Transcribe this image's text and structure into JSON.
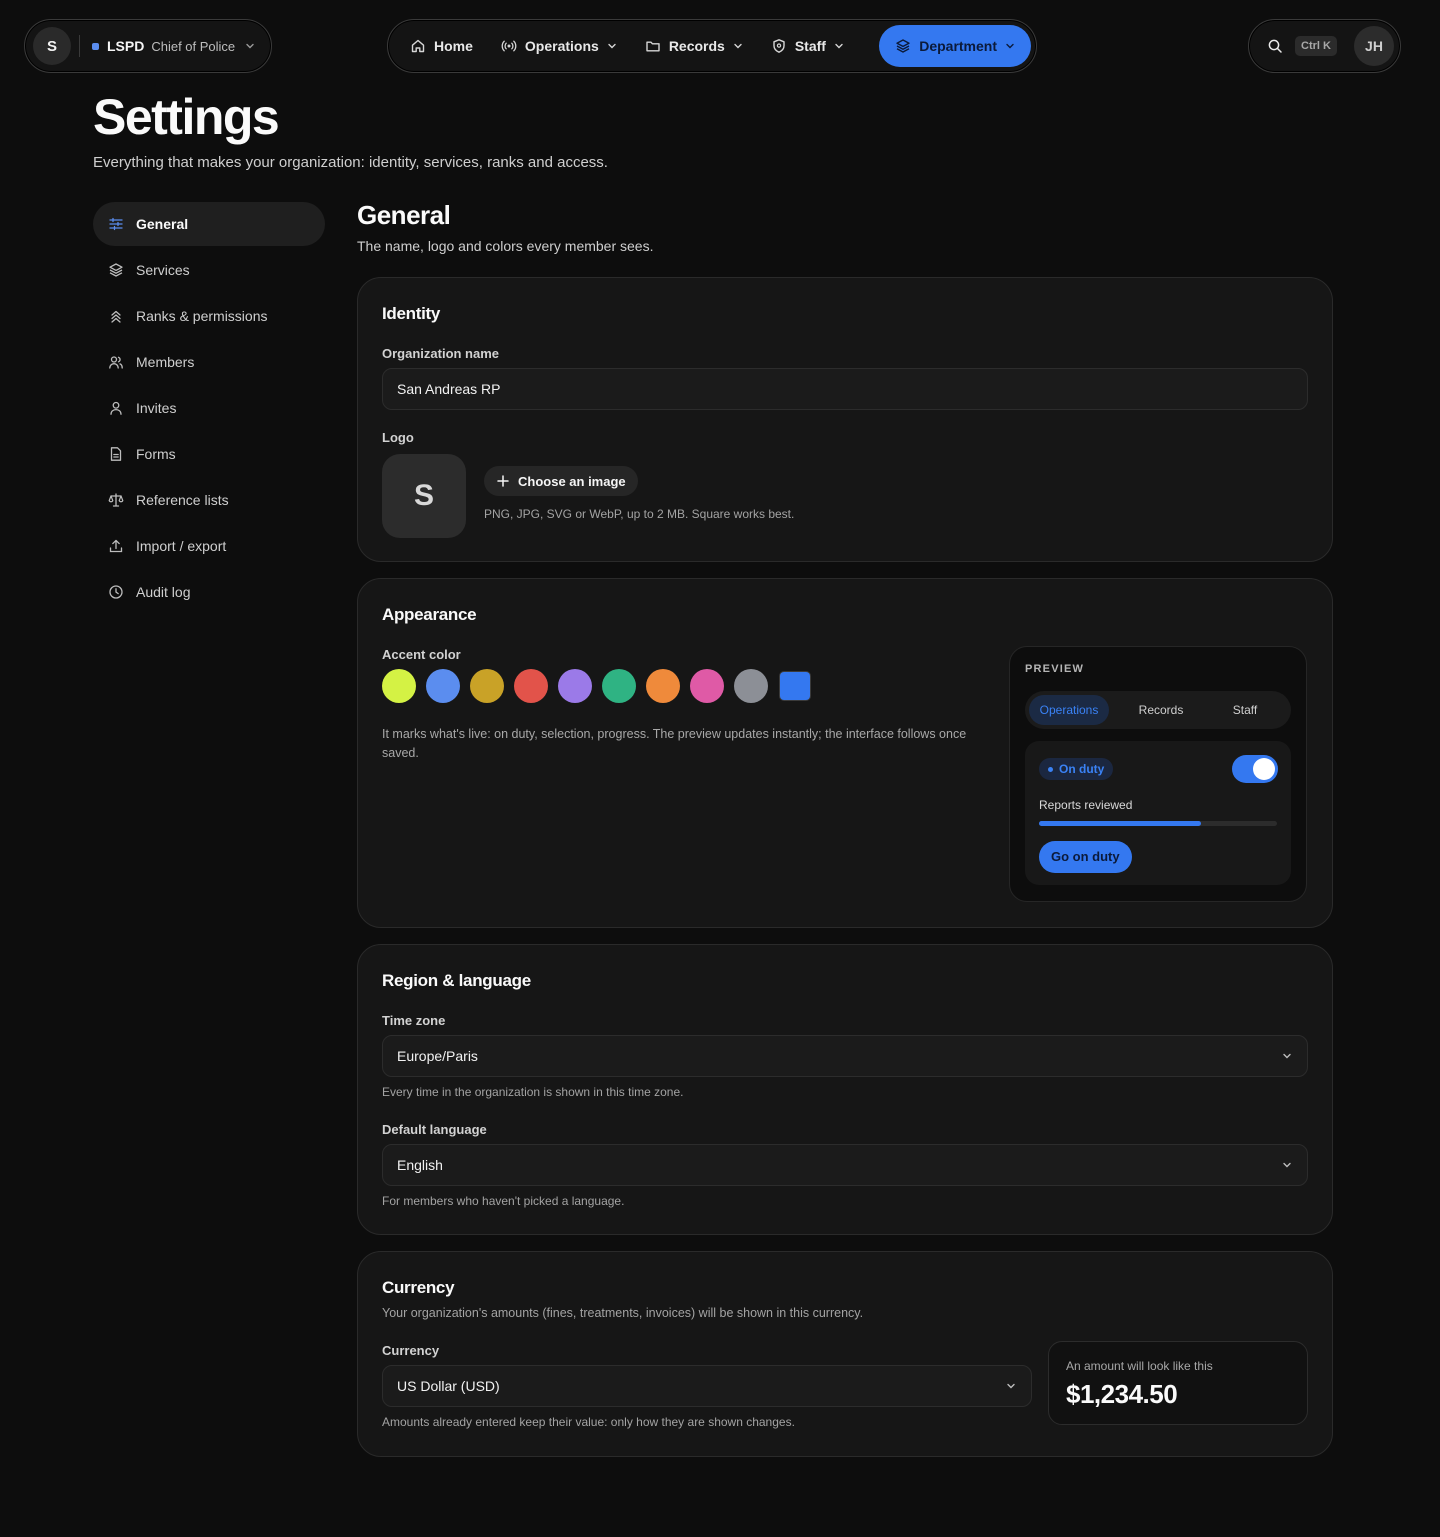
{
  "topbar": {
    "org_initial": "S",
    "org_name": "LSPD",
    "org_role": "Chief of Police",
    "nav": [
      {
        "label": "Home",
        "icon": "home-icon",
        "has_menu": false
      },
      {
        "label": "Operations",
        "icon": "broadcast-icon",
        "has_menu": true
      },
      {
        "label": "Records",
        "icon": "folder-icon",
        "has_menu": true
      },
      {
        "label": "Staff",
        "icon": "shield-icon",
        "has_menu": true
      },
      {
        "label": "Department",
        "icon": "layers-icon",
        "has_menu": true,
        "active": true
      }
    ],
    "shortcut": "Ctrl K",
    "user_initials": "JH"
  },
  "header": {
    "title": "Settings",
    "subtitle": "Everything that makes your organization: identity, services, ranks and access."
  },
  "sidebar": {
    "items": [
      {
        "label": "General",
        "icon": "sliders-icon",
        "active": true
      },
      {
        "label": "Services",
        "icon": "layers-icon"
      },
      {
        "label": "Ranks & permissions",
        "icon": "chevrons-up-icon"
      },
      {
        "label": "Members",
        "icon": "users-icon"
      },
      {
        "label": "Invites",
        "icon": "user-icon"
      },
      {
        "label": "Forms",
        "icon": "file-icon"
      },
      {
        "label": "Reference lists",
        "icon": "scale-icon"
      },
      {
        "label": "Import / export",
        "icon": "upload-icon"
      },
      {
        "label": "Audit log",
        "icon": "clock-icon"
      }
    ]
  },
  "section": {
    "title": "General",
    "subtitle": "The name, logo and colors every member sees."
  },
  "identity": {
    "title": "Identity",
    "org_name_label": "Organization name",
    "org_name_value": "San Andreas RP",
    "logo_label": "Logo",
    "logo_initial": "S",
    "choose_button": "Choose an image",
    "logo_hint": "PNG, JPG, SVG or WebP, up to 2 MB. Square works best."
  },
  "appearance": {
    "title": "Appearance",
    "accent_label": "Accent color",
    "accent_colors": [
      "#d4f244",
      "#5b8def",
      "#c9a227",
      "#e2534a",
      "#9b7ae8",
      "#2fb383",
      "#ef8a3b",
      "#df5aa6",
      "#8c8f96"
    ],
    "custom_color": "#3478f0",
    "accent_hint": "It marks what's live: on duty, selection, progress. The preview updates instantly; the interface follows once saved.",
    "preview": {
      "label": "PREVIEW",
      "tabs": [
        "Operations",
        "Records",
        "Staff"
      ],
      "active_tab": "Operations",
      "badge": "On duty",
      "toggle_on": true,
      "progress_label": "Reports reviewed",
      "progress_fraction": 0.68,
      "button": "Go on duty"
    }
  },
  "region": {
    "title": "Region & language",
    "timezone_label": "Time zone",
    "timezone_value": "Europe/Paris",
    "timezone_hint": "Every time in the organization is shown in this time zone.",
    "language_label": "Default language",
    "language_value": "English",
    "language_hint": "For members who haven't picked a language."
  },
  "currency": {
    "title": "Currency",
    "subtitle": "Your organization's amounts (fines, treatments, invoices) will be shown in this currency.",
    "label": "Currency",
    "value": "US Dollar (USD)",
    "hint": "Amounts already entered keep their value: only how they are shown changes.",
    "preview_caption": "An amount will look like this",
    "preview_amount": "$1,234.50"
  },
  "colors": {
    "accent": "#3478f0",
    "background": "#0d0d0d",
    "card": "#161616"
  }
}
